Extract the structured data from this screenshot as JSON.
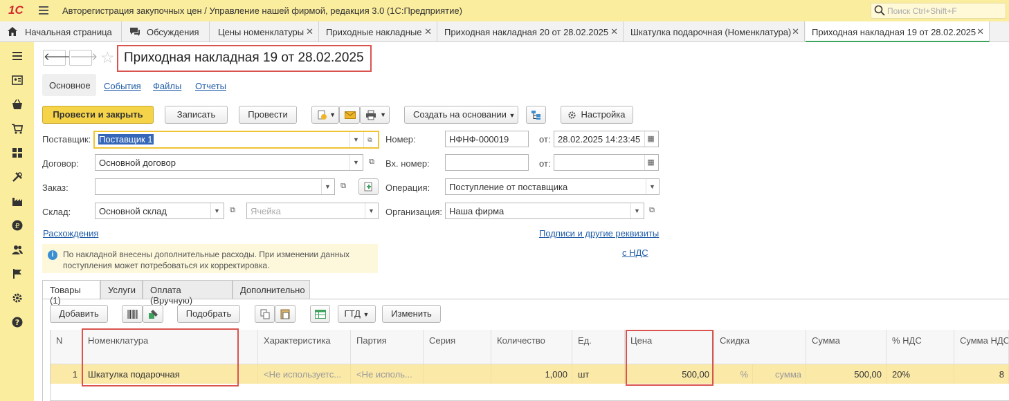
{
  "app": {
    "logo": "1С",
    "title": "Авторегистрация закупочных цен / Управление нашей фирмой, редакция 3.0  (1С:Предприятие)",
    "search_placeholder": "Поиск Ctrl+Shift+F"
  },
  "tabs": [
    {
      "label": "Начальная страница"
    },
    {
      "label": "Обсуждения"
    },
    {
      "label": "Цены номенклатуры"
    },
    {
      "label": "Приходные накладные"
    },
    {
      "label": "Приходная накладная 20 от 28.02.2025"
    },
    {
      "label": "Шкатулка подарочная (Номенклатура)"
    },
    {
      "label": "Приходная накладная 19 от 28.02.2025"
    }
  ],
  "document": {
    "title": "Приходная накладная 19 от 28.02.2025",
    "subtabs": [
      "Основное",
      "События",
      "Файлы",
      "Отчеты"
    ]
  },
  "toolbar": {
    "post_close": "Провести и закрыть",
    "save": "Записать",
    "post": "Провести",
    "create_based": "Создать на основании",
    "settings": "Настройка"
  },
  "form": {
    "supplier_label": "Поставщик:",
    "supplier_value": "Поставщик 1",
    "contract_label": "Договор:",
    "contract_value": "Основной договор",
    "order_label": "Заказ:",
    "order_value": "",
    "warehouse_label": "Склад:",
    "warehouse_value": "Основной склад",
    "cell_placeholder": "Ячейка",
    "number_label": "Номер:",
    "number_value": "НФНФ-000019",
    "from_label": "от:",
    "date_value": "28.02.2025 14:23:45",
    "in_number_label": "Вх. номер:",
    "in_number_value": "",
    "in_date_value": "  .  .",
    "operation_label": "Операция:",
    "operation_value": "Поступление от поставщика",
    "org_label": "Организация:",
    "org_value": "Наша фирма",
    "expenses_link": "Расхождения",
    "signatures_link": "Подписи и другие реквизиты",
    "vat_link": "с НДС",
    "info_text": "По накладной внесены дополнительные расходы. При изменении данных поступления может потребоваться их корректировка."
  },
  "detail_tabs": [
    "Товары (1)",
    "Услуги",
    "Оплата (Вручную)",
    "Дополнительно"
  ],
  "grid_toolbar": {
    "add": "Добавить",
    "pick": "Подобрать",
    "gtd": "ГТД",
    "change": "Изменить"
  },
  "grid": {
    "headers": [
      "N",
      "Номенклатура",
      "Характеристика",
      "Партия",
      "Серия",
      "Количество",
      "Ед.",
      "Цена",
      "Скидка",
      "Сумма",
      "% НДС",
      "Сумма НДС"
    ],
    "row": {
      "n": "1",
      "item": "Шкатулка подарочная",
      "characteristic": "<Не используетс...",
      "batch": "<Не исполь...",
      "series": "",
      "qty": "1,000",
      "unit": "шт",
      "price": "500,00",
      "discount_pct": "%",
      "discount_sum": "сумма",
      "sum": "500,00",
      "vat_pct": "20%",
      "vat_sum": "8"
    }
  },
  "colors": {
    "accent": "#fbed9e",
    "highlight_border": "#d9534f",
    "primary_button": "#f6d44a"
  }
}
